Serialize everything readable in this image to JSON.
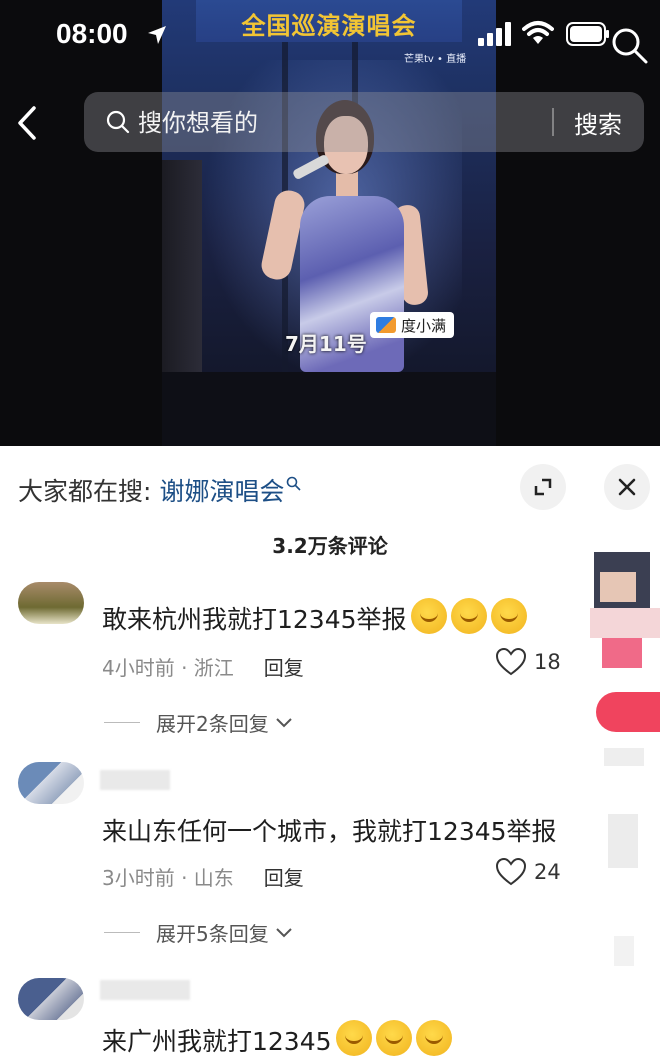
{
  "status_bar": {
    "time": "08:00"
  },
  "video": {
    "banner": "全国巡演演唱会",
    "brand": "芒果tv • 直播",
    "caption": "7月11号",
    "watermark": "度小满"
  },
  "search": {
    "placeholder": "搜你想看的",
    "button": "搜索"
  },
  "panel": {
    "hot_search_label": "大家都在搜:",
    "hot_search_keyword": "谢娜演唱会",
    "comment_count": "3.2万条评论"
  },
  "comments": [
    {
      "text": "敢来杭州我就打12345举报",
      "time_location": "4小时前 · 浙江",
      "reply": "回复",
      "likes": "18",
      "more_replies": "展开2条回复"
    },
    {
      "text": "来山东任何一个城市，我就打12345举报",
      "time_location": "3小时前 · 山东",
      "reply": "回复",
      "likes": "24",
      "more_replies": "展开5条回复"
    },
    {
      "text": "来广州我就打12345"
    }
  ]
}
